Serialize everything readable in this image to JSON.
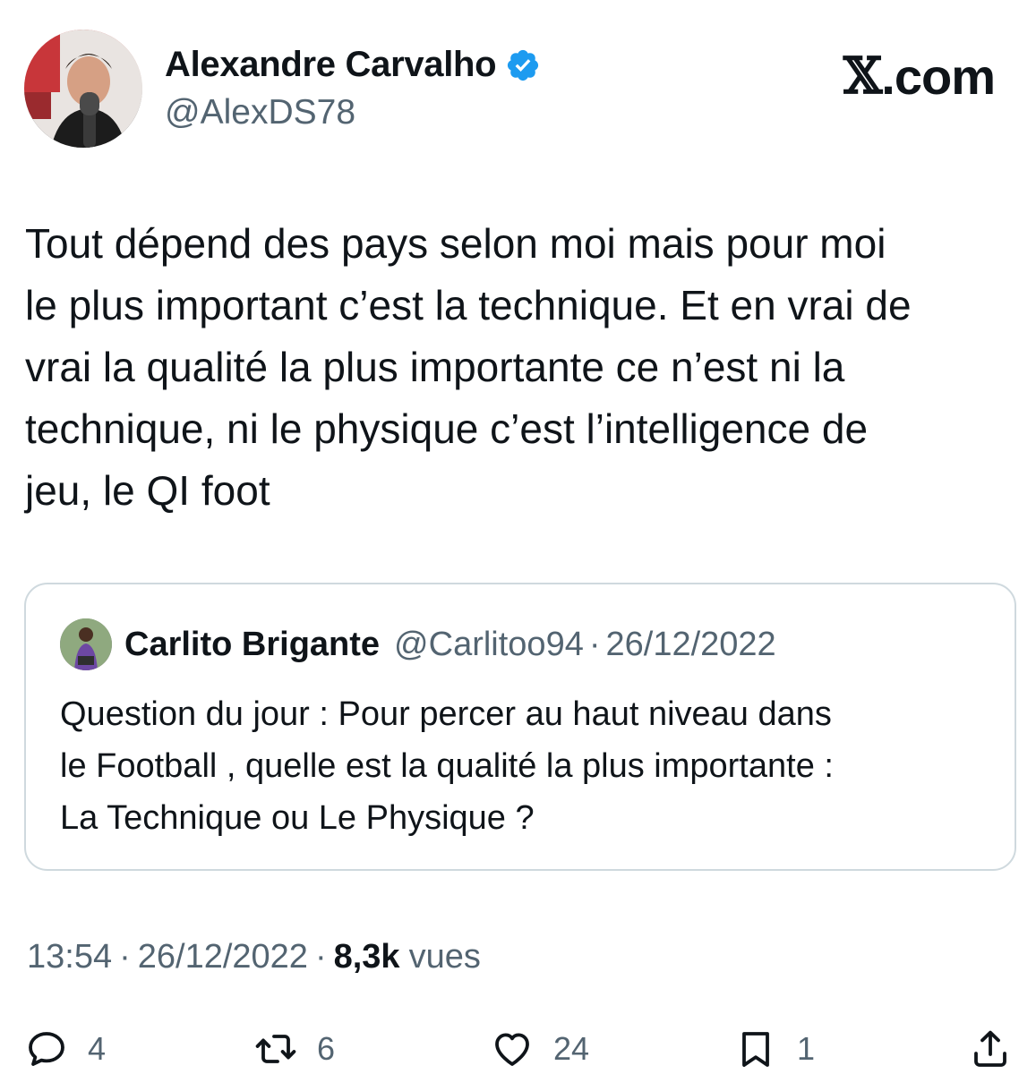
{
  "author": {
    "name": "Alexandre Carvalho",
    "handle": "@AlexDS78",
    "verified": true,
    "verified_color": "#1d9bf0"
  },
  "brand": {
    "logo_letter": "𝕏",
    "logo_suffix": ".com"
  },
  "tweet": {
    "text": "Tout dépend des pays selon moi mais pour moi\nle plus important c’est la technique. Et en vrai de\nvrai la qualité la plus importante ce n’est ni la\ntechnique, ni le physique c’est l’intelligence de\njeu, le QI foot"
  },
  "quote": {
    "name": "Carlito Brigante",
    "handle": "@Carlitoo94",
    "separator": "·",
    "date": "26/12/2022",
    "text": "Question du jour : Pour percer au haut niveau dans\nle Football , quelle est la qualité la plus importante :\nLa Technique ou Le Physique ?"
  },
  "meta": {
    "time": "13:54",
    "separator": "·",
    "date": "26/12/2022",
    "views_count": "8,3k",
    "views_label": "vues"
  },
  "actions": {
    "reply": {
      "icon": "reply-icon",
      "count": "4"
    },
    "retweet": {
      "icon": "retweet-icon",
      "count": "6"
    },
    "like": {
      "icon": "heart-icon",
      "count": "24"
    },
    "bookmark": {
      "icon": "bookmark-icon",
      "count": "1"
    },
    "share": {
      "icon": "share-icon"
    }
  },
  "colors": {
    "text_primary": "#0f1419",
    "text_secondary": "#536471",
    "border": "#cfd9de",
    "accent": "#1d9bf0"
  }
}
